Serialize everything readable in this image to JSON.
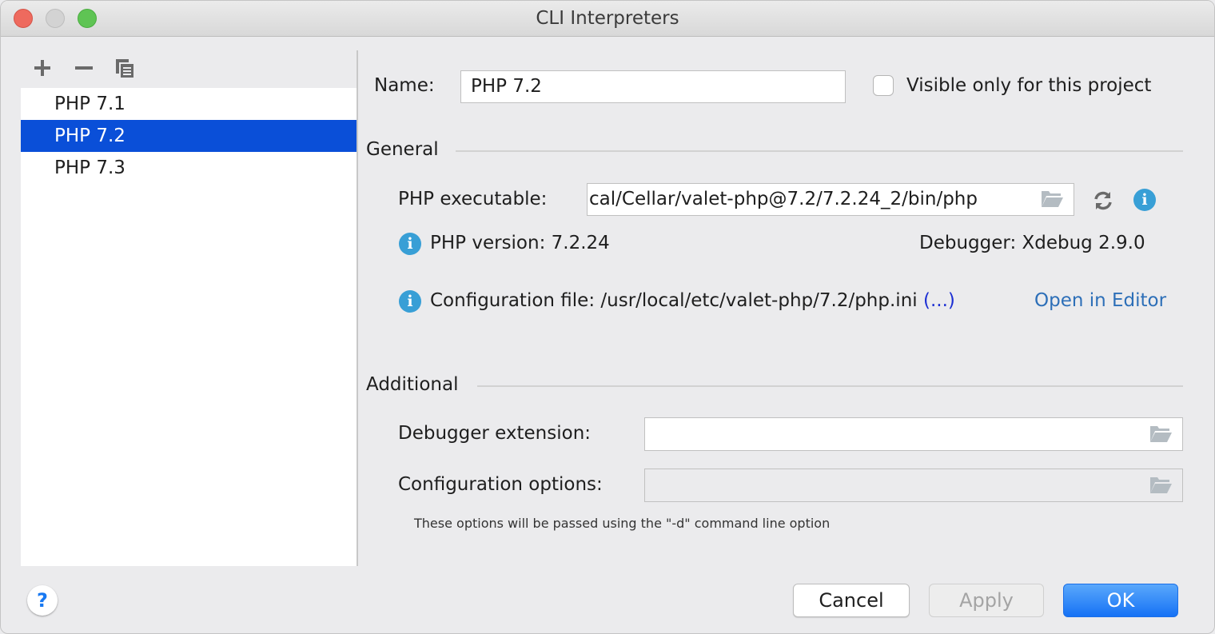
{
  "window": {
    "title": "CLI Interpreters"
  },
  "toolbar": {
    "add_icon": "plus-icon",
    "remove_icon": "minus-icon",
    "copy_icon": "copy-icon"
  },
  "interpreters": [
    {
      "label": "PHP 7.1",
      "selected": false
    },
    {
      "label": "PHP 7.2",
      "selected": true
    },
    {
      "label": "PHP 7.3",
      "selected": false
    }
  ],
  "form": {
    "name_label": "Name:",
    "name_value": "PHP 7.2",
    "visible_only_label": "Visible only for this project",
    "visible_only_checked": false,
    "general": {
      "section_title": "General",
      "php_executable_label": "PHP executable:",
      "php_executable_value": "cal/Cellar/valet-php@7.2/7.2.24_2/bin/php",
      "php_version_text": "PHP version: 7.2.24",
      "debugger_text": "Debugger: Xdebug 2.9.0",
      "config_file_text": "Configuration file: /usr/local/etc/valet-php/7.2/php.ini",
      "config_more_link": "(...)",
      "open_in_editor_link": "Open in Editor"
    },
    "additional": {
      "section_title": "Additional",
      "debugger_extension_label": "Debugger extension:",
      "debugger_extension_value": "",
      "configuration_options_label": "Configuration options:",
      "configuration_options_value": "",
      "hint": "These options will be passed using the \"-d\" command line option"
    }
  },
  "buttons": {
    "help": "?",
    "cancel": "Cancel",
    "apply": "Apply",
    "ok": "OK"
  },
  "colors": {
    "selection": "#0a4fd8",
    "accent_ok": "#1672f5",
    "info_icon": "#389fd6",
    "link": "#2d6fb8"
  }
}
